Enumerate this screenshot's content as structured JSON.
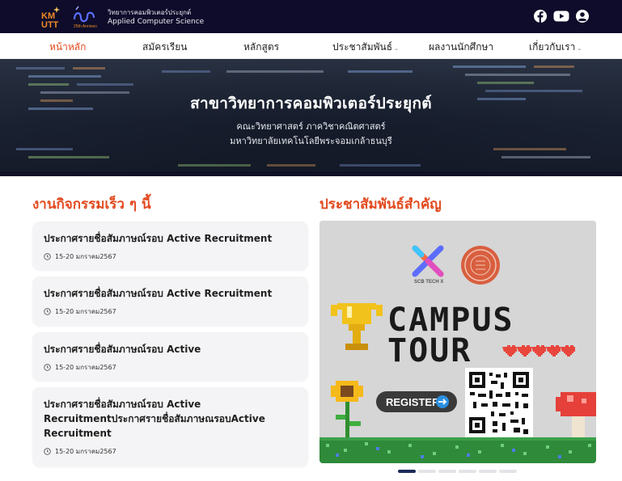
{
  "header": {
    "logo_kmutt": "KMUTT",
    "logo_acs_badge": "25th Anniversary",
    "org_name_th": "วิทยาการคอมพิวเตอร์ประยุกต์",
    "org_name_en": "Applied Computer Science",
    "social_icons": [
      "facebook-icon",
      "youtube-icon",
      "account-icon"
    ]
  },
  "nav": {
    "items": [
      {
        "label": "หน้าหลัก",
        "active": true
      },
      {
        "label": "สมัครเรียน"
      },
      {
        "label": "หลักสูตร"
      },
      {
        "label": "ประชาสัมพันธ์",
        "dropdown": true
      },
      {
        "label": "ผลงานนักศึกษา"
      },
      {
        "label": "เกี่ยวกับเรา",
        "dropdown": true
      }
    ],
    "caret": "⌄"
  },
  "hero": {
    "title": "สาขาวิทยาการคอมพิวเตอร์ประยุกต์",
    "subtitle1": "คณะวิทยาศาสตร์ ภาควิชาคณิตศาสตร์",
    "subtitle2": "มหาวิทยาลัยเทคโนโลยีพระจอมเกล้าธนบุรี"
  },
  "activities": {
    "title": "งานกิจกรรมเร็ว ๆ นี้",
    "items": [
      {
        "title": "ประกาศรายชื่อสัมภาษณ์รอบ Active Recruitment",
        "date": "15-20 มกราคม2567"
      },
      {
        "title": "ประกาศรายชื่อสัมภาษณ์รอบ Active Recruitment",
        "date": "15-20 มกราคม2567"
      },
      {
        "title": "ประกาศรายชื่อสัมภาษณ์รอบ Active",
        "date": "15-20 มกราคม2567"
      },
      {
        "title": "ประกาศรายชื่อสัมภาษณ์รอบ Active Recruitmentประกาศรายชื่อสัมภาษณรอบActive Recruitment",
        "date": "15-20 มกราคม2567"
      }
    ]
  },
  "announcements": {
    "title": "ประชาสัมพันธ์สำคัญ",
    "poster": {
      "brand": "SCB TECH X",
      "headline1": "CAMPUS",
      "headline2": "TOUR",
      "button": "REGISTER"
    },
    "carousel": {
      "count": 6,
      "active_index": 0
    }
  },
  "colors": {
    "accent": "#e2491e",
    "topbar": "#0e0c2a",
    "card": "#f4f4f6",
    "dot_active": "#1c2a5a"
  }
}
